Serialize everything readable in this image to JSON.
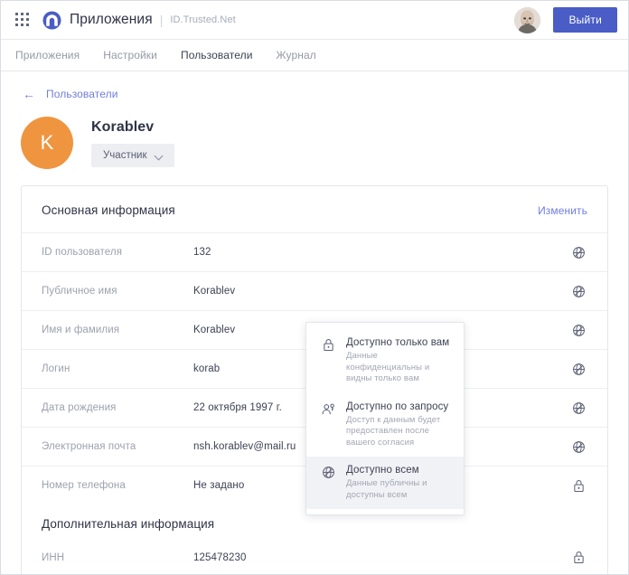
{
  "colors": {
    "accent_blue": "#4a5cc5",
    "link_blue": "#6f7ee0",
    "avatar_orange": "#ef9540",
    "text_dark": "#2f3346",
    "text_muted": "#9da1ae",
    "selected_bg": "#f1f2f5"
  },
  "topbar": {
    "grid_icon": "apps-grid-icon",
    "logo_icon": "brand-circle-logo",
    "title": "Приложения",
    "separator": "|",
    "subtitle": "ID.Trusted.Net",
    "avatar_icon": "user-photo-avatar",
    "logout_label": "Выйти"
  },
  "tabs": [
    {
      "label": "Приложения",
      "active": false
    },
    {
      "label": "Настройки",
      "active": false
    },
    {
      "label": "Пользователи",
      "active": true
    },
    {
      "label": "Журнал",
      "active": false
    }
  ],
  "breadcrumb": {
    "back_icon": "arrow-left-icon",
    "label": "Пользователи"
  },
  "profile": {
    "initial": "K",
    "name": "Korablev",
    "role_label": "Участник",
    "chevron_icon": "chevron-down-icon"
  },
  "card": {
    "title": "Основная информация",
    "edit_label": "Изменить",
    "rows": [
      {
        "label": "ID пользователя",
        "value": "132",
        "icon": "globe-icon"
      },
      {
        "label": "Публичное имя",
        "value": "Korablev",
        "icon": "globe-icon"
      },
      {
        "label": "Имя и фамилия",
        "value": "Korablev",
        "icon": "globe-icon"
      },
      {
        "label": "Логин",
        "value": "korab",
        "icon": "globe-icon"
      },
      {
        "label": "Дата рождения",
        "value": "22 октября 1997 г.",
        "icon": "globe-icon"
      },
      {
        "label": "Электронная почта",
        "value": "nsh.korablev@mail.ru",
        "icon": "globe-icon"
      },
      {
        "label": "Номер телефона",
        "value": "Не задано",
        "icon": "lock-icon"
      }
    ],
    "section2_title": "Дополнительная информация",
    "rows2": [
      {
        "label": "ИНН",
        "value": "125478230",
        "icon": "lock-icon"
      }
    ]
  },
  "dropdown": {
    "items": [
      {
        "icon": "lock-icon",
        "title": "Доступно только вам",
        "desc": "Данные конфиденциальны и видны только вам",
        "selected": false
      },
      {
        "icon": "person-key-icon",
        "title": "Доступно по запросу",
        "desc": "Доступ к данным будет предоставлен после вашего согласия",
        "selected": false
      },
      {
        "icon": "globe-icon",
        "title": "Доступно всем",
        "desc": "Данные публичны и доступны всем",
        "selected": true
      }
    ]
  }
}
